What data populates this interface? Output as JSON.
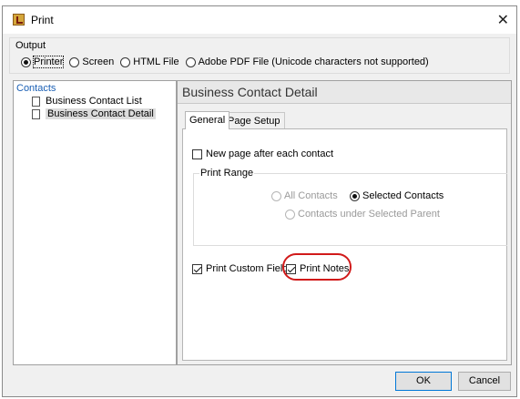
{
  "window": {
    "title": "Print",
    "close_glyph": "✕"
  },
  "output": {
    "legend": "Output",
    "options": [
      {
        "label": "Printer",
        "selected": true
      },
      {
        "label": "Screen",
        "selected": false
      },
      {
        "label": "HTML File",
        "selected": false
      },
      {
        "label": "Adobe PDF File (Unicode characters not supported)",
        "selected": false
      }
    ]
  },
  "tree": {
    "root": "Contacts",
    "items": [
      {
        "label": "Business Contact List",
        "selected": false
      },
      {
        "label": "Business Contact Detail",
        "selected": true
      }
    ]
  },
  "detail": {
    "title": "Business Contact Detail",
    "tabs": [
      {
        "label": "General",
        "active": true
      },
      {
        "label": "Page Setup",
        "active": false
      }
    ],
    "new_page_label": "New page after each contact",
    "new_page_checked": false,
    "print_range": {
      "legend": "Print Range",
      "all_contacts": "All Contacts",
      "selected_contacts": "Selected Contacts",
      "under_parent": "Contacts under Selected Parent",
      "selected_option": "Selected Contacts"
    },
    "print_custom_fields_label": "Print Custom Fields",
    "print_custom_fields_checked": true,
    "print_notes_label": "Print Notes",
    "print_notes_checked": true
  },
  "buttons": {
    "ok": "OK",
    "cancel": "Cancel"
  },
  "colors": {
    "highlight": "#d11a1a",
    "tree_root": "#1a5fb4",
    "ok_border": "#0078d7"
  }
}
